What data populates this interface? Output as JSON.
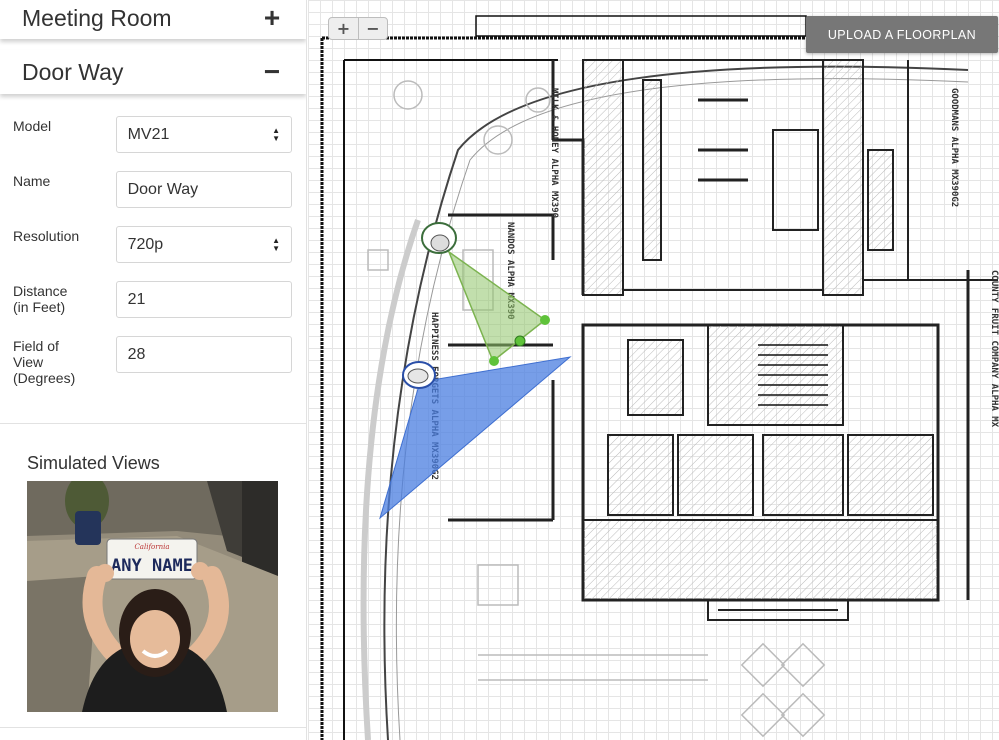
{
  "sidebar": {
    "sections": [
      {
        "title": "Meeting Room",
        "toggle": "+"
      },
      {
        "title": "Door Way",
        "toggle": "−"
      }
    ],
    "fields": {
      "model": {
        "label": "Model",
        "value": "MV21"
      },
      "name": {
        "label": "Name",
        "value": "Door Way"
      },
      "resolution": {
        "label": "Resolution",
        "value": "720p"
      },
      "distance": {
        "label_line1": "Distance",
        "label_line2": "(in Feet)",
        "value": "21"
      },
      "fov": {
        "label_line1": "Field of",
        "label_line2": "View",
        "label_line3": "(Degrees)",
        "value": "28"
      }
    },
    "simulated": {
      "title": "Simulated Views",
      "plate_top": "California",
      "plate_text": "ANY NAME"
    }
  },
  "map": {
    "zoom_in": "+",
    "zoom_out": "−",
    "upload_label": "UPLOAD A FLOORPLAN",
    "rooms": {
      "milk_honey": "MILK & HONEY ALPHA MX390",
      "nandos": "NANDOS ALPHA MX390",
      "happiness": "HAPPINESS FORGETS ALPHA MX390G2",
      "goodmans": "GOODMANS ALPHA MX390G2",
      "county": "COUNTY FRUIT COMPANY ALPHA MX"
    },
    "cameras": [
      {
        "name": "Meeting Room",
        "color": "#8fc46a"
      },
      {
        "name": "Door Way",
        "color": "#4a7de0"
      }
    ]
  }
}
